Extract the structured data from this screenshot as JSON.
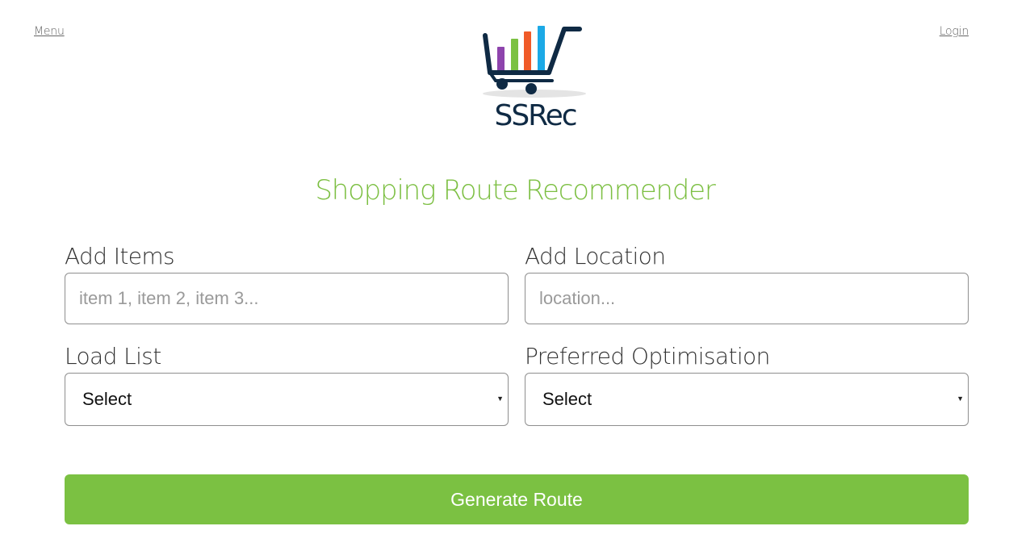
{
  "header": {
    "menu_label": "Menu",
    "login_label": "Login",
    "logo_text": "SSRec"
  },
  "page_title": "Shopping Route Recommender",
  "form": {
    "items": {
      "label": "Add Items",
      "placeholder": "item 1, item 2, item 3...",
      "value": ""
    },
    "location": {
      "label": "Add Location",
      "placeholder": "location...",
      "value": ""
    },
    "load_list": {
      "label": "Load List",
      "selected": "Select"
    },
    "optimisation": {
      "label": "Preferred Optimisation",
      "selected": "Select"
    },
    "submit_label": "Generate Route"
  },
  "colors": {
    "accent_green": "#7bc142",
    "logo_navy": "#0f2a44",
    "logo_bar_purple": "#8e44ad",
    "logo_bar_green": "#7bc142",
    "logo_bar_orange": "#f05a28",
    "logo_bar_blue": "#1ca9e6"
  }
}
